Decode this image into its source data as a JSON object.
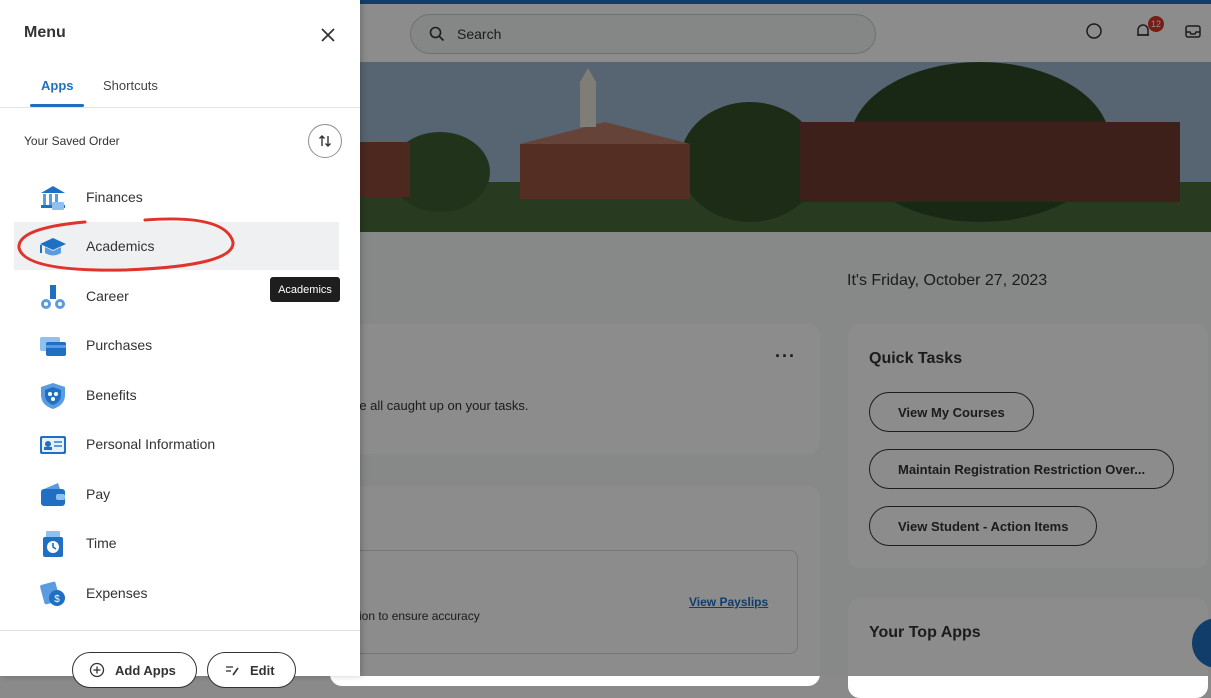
{
  "header": {
    "search_placeholder": "Search",
    "notification_count": "12"
  },
  "home": {
    "date": "It's Friday, October 27, 2023",
    "tasks_card": {
      "more_label": "···",
      "message": "re all caught up on your tasks."
    },
    "pay_card": {
      "message": "ion to ensure accuracy",
      "view_payslips": "View Payslips"
    },
    "quick_tasks": {
      "title": "Quick Tasks",
      "buttons": [
        "View My Courses",
        "Maintain Registration Restriction Over...",
        "View Student - Action Items"
      ]
    },
    "top_apps": {
      "title": "Your Top Apps"
    }
  },
  "menu": {
    "title": "Menu",
    "tabs": [
      {
        "label": "Apps",
        "active": true
      },
      {
        "label": "Shortcuts",
        "active": false
      }
    ],
    "saved_order_label": "Your Saved Order",
    "items": [
      {
        "label": "Finances",
        "icon": "bank-icon"
      },
      {
        "label": "Academics",
        "icon": "graduation-cap-icon"
      },
      {
        "label": "Career",
        "icon": "career-icon"
      },
      {
        "label": "Purchases",
        "icon": "purchases-icon"
      },
      {
        "label": "Benefits",
        "icon": "shield-icon"
      },
      {
        "label": "Personal Information",
        "icon": "id-card-icon"
      },
      {
        "label": "Pay",
        "icon": "wallet-icon"
      },
      {
        "label": "Time",
        "icon": "clock-icon"
      },
      {
        "label": "Expenses",
        "icon": "expenses-icon"
      }
    ],
    "tooltip": "Academics",
    "footer": {
      "add_apps": "Add Apps",
      "edit": "Edit"
    }
  },
  "colors": {
    "accent": "#1f6fc2",
    "annotation": "#e0332b",
    "badge": "#d9342b"
  }
}
